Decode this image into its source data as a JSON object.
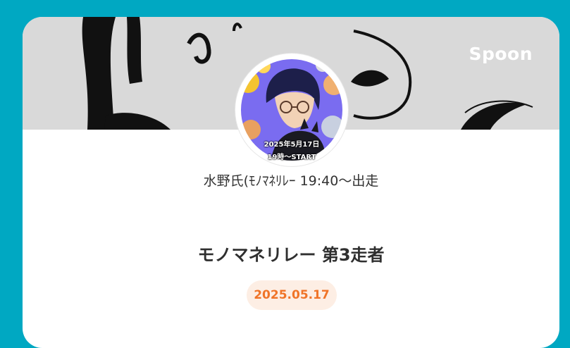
{
  "brand": {
    "name": "Spoon",
    "icon": "spoon-logo"
  },
  "banner": {
    "color": "#d9d9d9"
  },
  "profile": {
    "avatar_icon": "anime-avatar",
    "avatar_date": "2025年5月17日",
    "avatar_start": "19時〜START",
    "host_name": "水野氏(ﾓﾉﾏﾈﾘﾚｰ 19:40〜出走"
  },
  "live": {
    "title": "モノマネリレー 第3走者",
    "date": "2025.05.17"
  },
  "colors": {
    "background": "#00a8c2",
    "card": "#ffffff",
    "accent": "#f07428",
    "badge_bg": "#fdeee4"
  }
}
